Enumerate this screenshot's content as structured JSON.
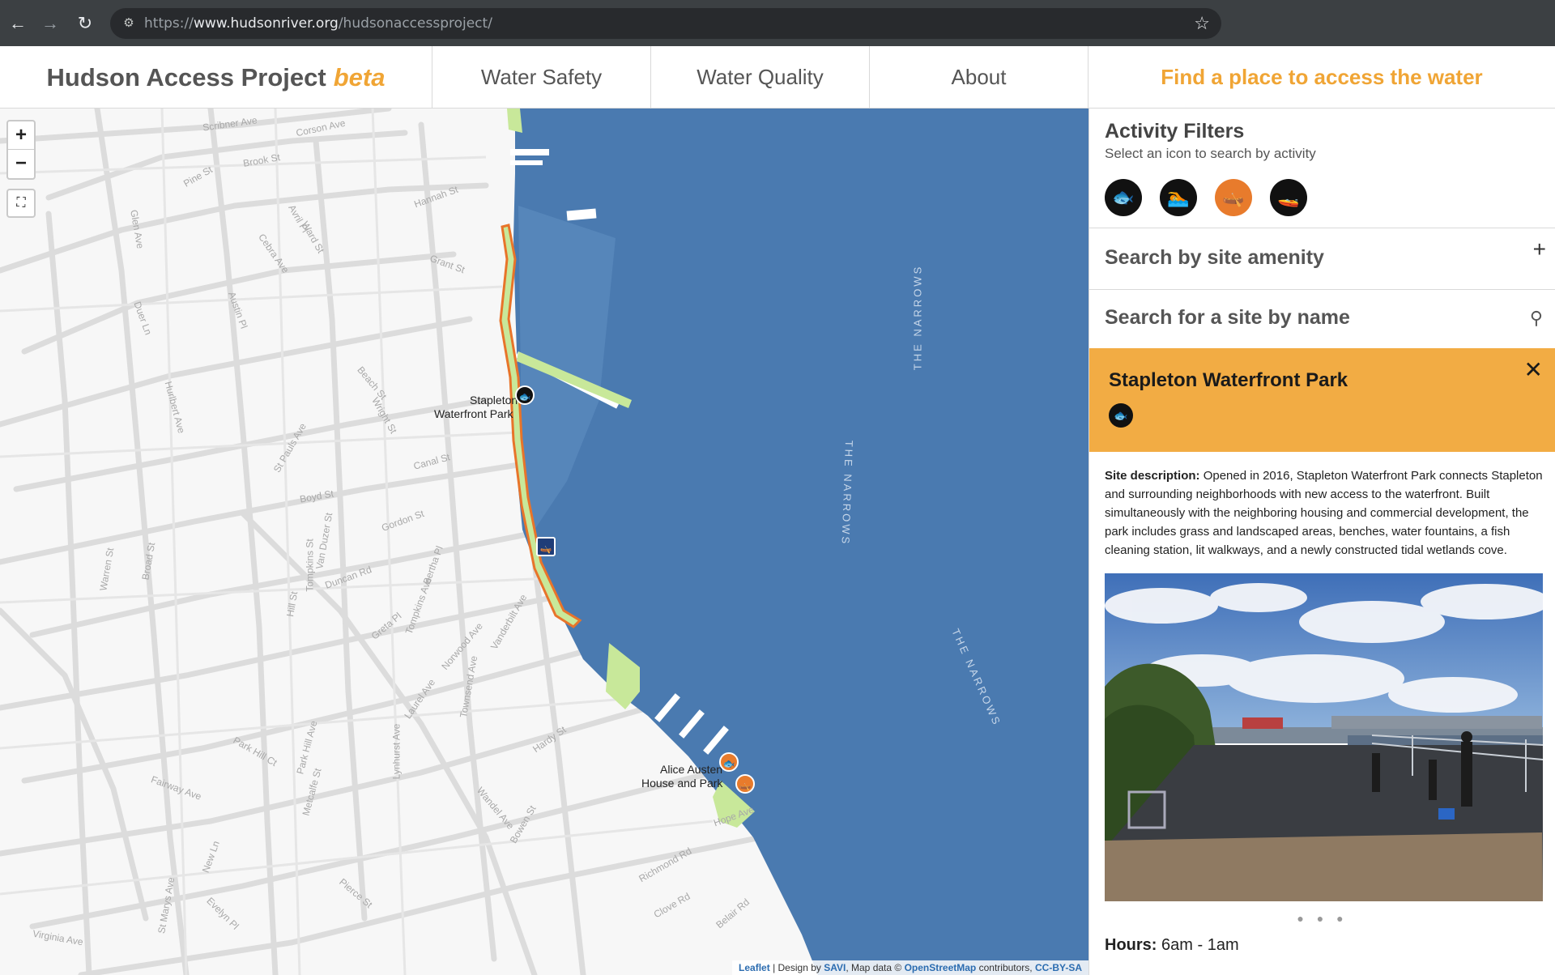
{
  "browser": {
    "url_prefix": "https://",
    "url_domain": "www.hudsonriver.org",
    "url_path": "/hudsonaccessproject/"
  },
  "header": {
    "brand": "Hudson Access Project",
    "beta": "beta",
    "tabs": [
      "Water Safety",
      "Water Quality",
      "About"
    ],
    "cta": "Find a place to access the water"
  },
  "map": {
    "zoom_in": "+",
    "zoom_out": "−",
    "street_labels": [
      "Scribner Ave",
      "Corson Ave",
      "Brook St",
      "Pine St",
      "Hannah St",
      "Avril Pl",
      "Glen Ave",
      "Cebra Ave",
      "Ward St",
      "Grant St",
      "Austin Pl",
      "Duer Ln",
      "Hurlbert Ave",
      "Beach St",
      "Wright St",
      "Canal St",
      "St Pauls Ave",
      "Boyd St",
      "Van Duzer St",
      "Gordon St",
      "Tompkins St",
      "Broad St",
      "Duncan Rd",
      "Greta Pl",
      "Bertha Pl",
      "Hill St",
      "Warren St",
      "Tompkins Ave",
      "Vanderbilt Ave",
      "Norwood Ave",
      "Townsend Ave",
      "Laurel Ave",
      "Park Hill Ct",
      "Park Hill Ave",
      "Fairway Ave",
      "Metcalfe St",
      "Hardy St",
      "Wandel Ave",
      "Bowen St",
      "Lynhurst Ave",
      "St Marys Ave",
      "Virginia Ave",
      "Richmond Rd",
      "Clove Rd",
      "Belair Rd",
      "Hope Ave",
      "Evelyn Pl",
      "New Ln",
      "Pierce St"
    ],
    "water_labels": [
      "THE NARROWS",
      "THE NARROWS",
      "THE NARROWS"
    ],
    "place_labels": [
      "Stapleton",
      "Waterfront Park",
      "Alice Austen",
      "House and Park"
    ],
    "attribution": {
      "leaflet": "Leaflet",
      "design_prefix": "| Design by",
      "savi": "SAVI",
      "map_data": ", Map data ©",
      "osm": "OpenStreetMap",
      "contributors": "contributors,",
      "license": "CC-BY-SA"
    }
  },
  "panel": {
    "filters_title": "Activity Filters",
    "filters_subtitle": "Select an icon to search by activity",
    "activities": [
      {
        "name": "fishing",
        "icon": "fish-icon",
        "glyph": "🐟",
        "active": false
      },
      {
        "name": "swimming",
        "icon": "swimmer-icon",
        "glyph": "🏊",
        "active": false
      },
      {
        "name": "paddling",
        "icon": "kayak-icon",
        "glyph": "🛶",
        "active": true
      },
      {
        "name": "boating",
        "icon": "boat-icon",
        "glyph": "🚤",
        "active": false
      }
    ],
    "amenity_label": "Search by site amenity",
    "amenity_toggle": "+",
    "name_search_label": "Search for a site by name",
    "site": {
      "name": "Stapleton Waterfront Park",
      "close": "✕",
      "desc_label": "Site description:",
      "description": "Opened in 2016, Stapleton Waterfront Park connects Stapleton and surrounding neighborhoods with new access to the waterfront. Built simultaneously with the neighboring housing and commercial development, the park includes grass and landscaped areas, benches, water fountains, a fish cleaning station, lit walkways, and a newly constructed tidal wetlands cove.",
      "photo_count": 3,
      "photo_current": 1,
      "hours_label": "Hours:",
      "hours": "6am - 1am"
    }
  },
  "colors": {
    "accent": "#f0a535",
    "card": "#f2ac44",
    "water": "#4a7ab0",
    "park": "#c8e89a",
    "trail": "#e8742a",
    "active_filter": "#e87b2c"
  }
}
